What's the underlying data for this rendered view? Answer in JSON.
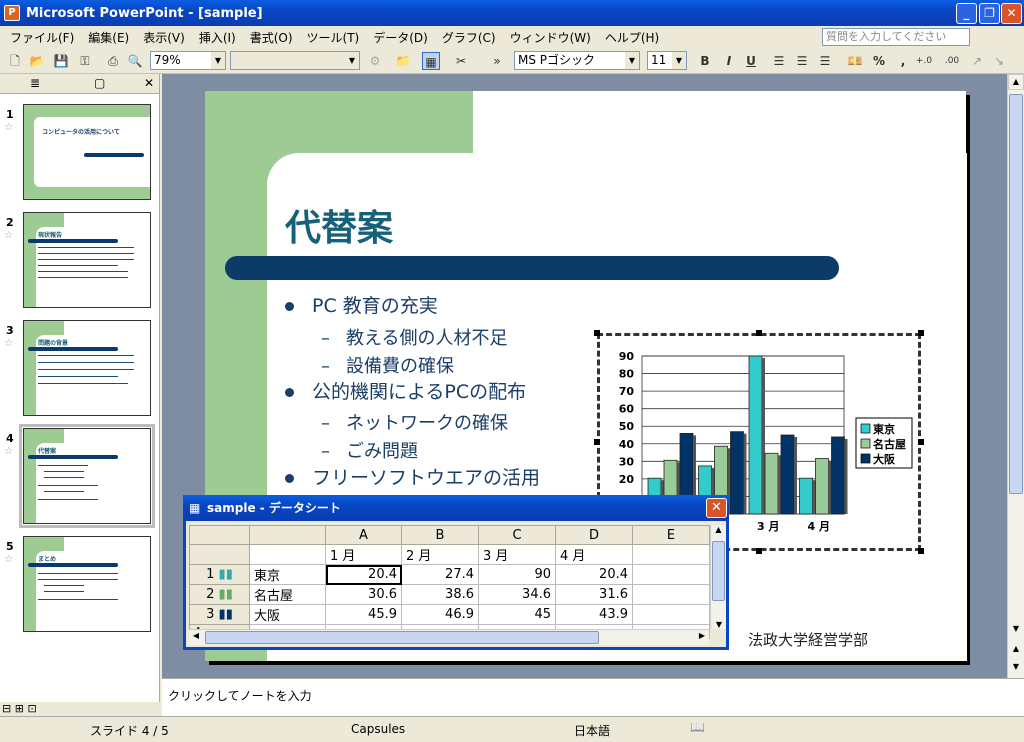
{
  "window": {
    "title": "Microsoft PowerPoint - [sample]",
    "app_icon": "P",
    "min_label": "_",
    "max_label": "❐",
    "close_label": "✕"
  },
  "menu": {
    "items": [
      "ファイル(F)",
      "編集(E)",
      "表示(V)",
      "挿入(I)",
      "書式(O)",
      "ツール(T)",
      "データ(D)",
      "グラフ(C)",
      "ウィンドウ(W)",
      "ヘルプ(H)"
    ],
    "help_placeholder": "質問を入力してください"
  },
  "toolbar": {
    "zoom": "79%",
    "font": "MS Pゴシック",
    "size": "11",
    "bold": "B",
    "italic": "I",
    "underline": "U",
    "percent": "%",
    "comma": ",",
    "inc_dec": "+.0",
    "dec_dec": ".00"
  },
  "slides": [
    {
      "num": "1",
      "title": "コンピュータの活用について"
    },
    {
      "num": "2",
      "title": "現状報告"
    },
    {
      "num": "3",
      "title": "問題の背景"
    },
    {
      "num": "4",
      "title": "代替案"
    },
    {
      "num": "5",
      "title": "まとめ"
    }
  ],
  "slide": {
    "title": "代替案",
    "bullets": [
      {
        "text": "PC 教育の充実",
        "subs": [
          "教える側の人材不足",
          "設備費の確保"
        ]
      },
      {
        "text": "公的機関によるPCの配布",
        "subs": [
          "ネットワークの確保",
          "ごみ問題"
        ]
      },
      {
        "text": "フリーソフトウエアの活用",
        "subs": []
      }
    ],
    "footer": "法政大学経営学部"
  },
  "chart_data": {
    "type": "bar",
    "categories": [
      "1 月",
      "2 月",
      "3 月",
      "4 月"
    ],
    "series": [
      {
        "name": "東京",
        "values": [
          20.4,
          27.4,
          90,
          20.4
        ],
        "color": "#33cccc"
      },
      {
        "name": "名古屋",
        "values": [
          30.6,
          38.6,
          34.6,
          31.6
        ],
        "color": "#99cc99"
      },
      {
        "name": "大阪",
        "values": [
          45.9,
          46.9,
          45,
          43.9
        ],
        "color": "#003366"
      }
    ],
    "yticks": [
      "90",
      "80",
      "70",
      "60",
      "50",
      "40",
      "30",
      "20"
    ],
    "xticks_visible": [
      "3 月",
      "4 月"
    ],
    "ylim": [
      0,
      90
    ],
    "legend": "right",
    "grid": true
  },
  "datasheet": {
    "title": "sample - データシート",
    "columns": [
      "A",
      "B",
      "C",
      "D",
      "E"
    ],
    "header_row": [
      "1 月",
      "2 月",
      "3 月",
      "4 月",
      ""
    ],
    "rows": [
      {
        "num": "1",
        "name": "東京",
        "values": [
          "20.4",
          "27.4",
          "90",
          "20.4",
          ""
        ]
      },
      {
        "num": "2",
        "name": "名古屋",
        "values": [
          "30.6",
          "38.6",
          "34.6",
          "31.6",
          ""
        ]
      },
      {
        "num": "3",
        "name": "大阪",
        "values": [
          "45.9",
          "46.9",
          "45",
          "43.9",
          ""
        ]
      },
      {
        "num": "4",
        "name": "",
        "values": [
          "",
          "",
          "",
          "",
          ""
        ]
      }
    ]
  },
  "notes": {
    "placeholder": "クリックしてノートを入力"
  },
  "status": {
    "slide": "スライド 4 / 5",
    "design": "Capsules",
    "language": "日本語"
  }
}
